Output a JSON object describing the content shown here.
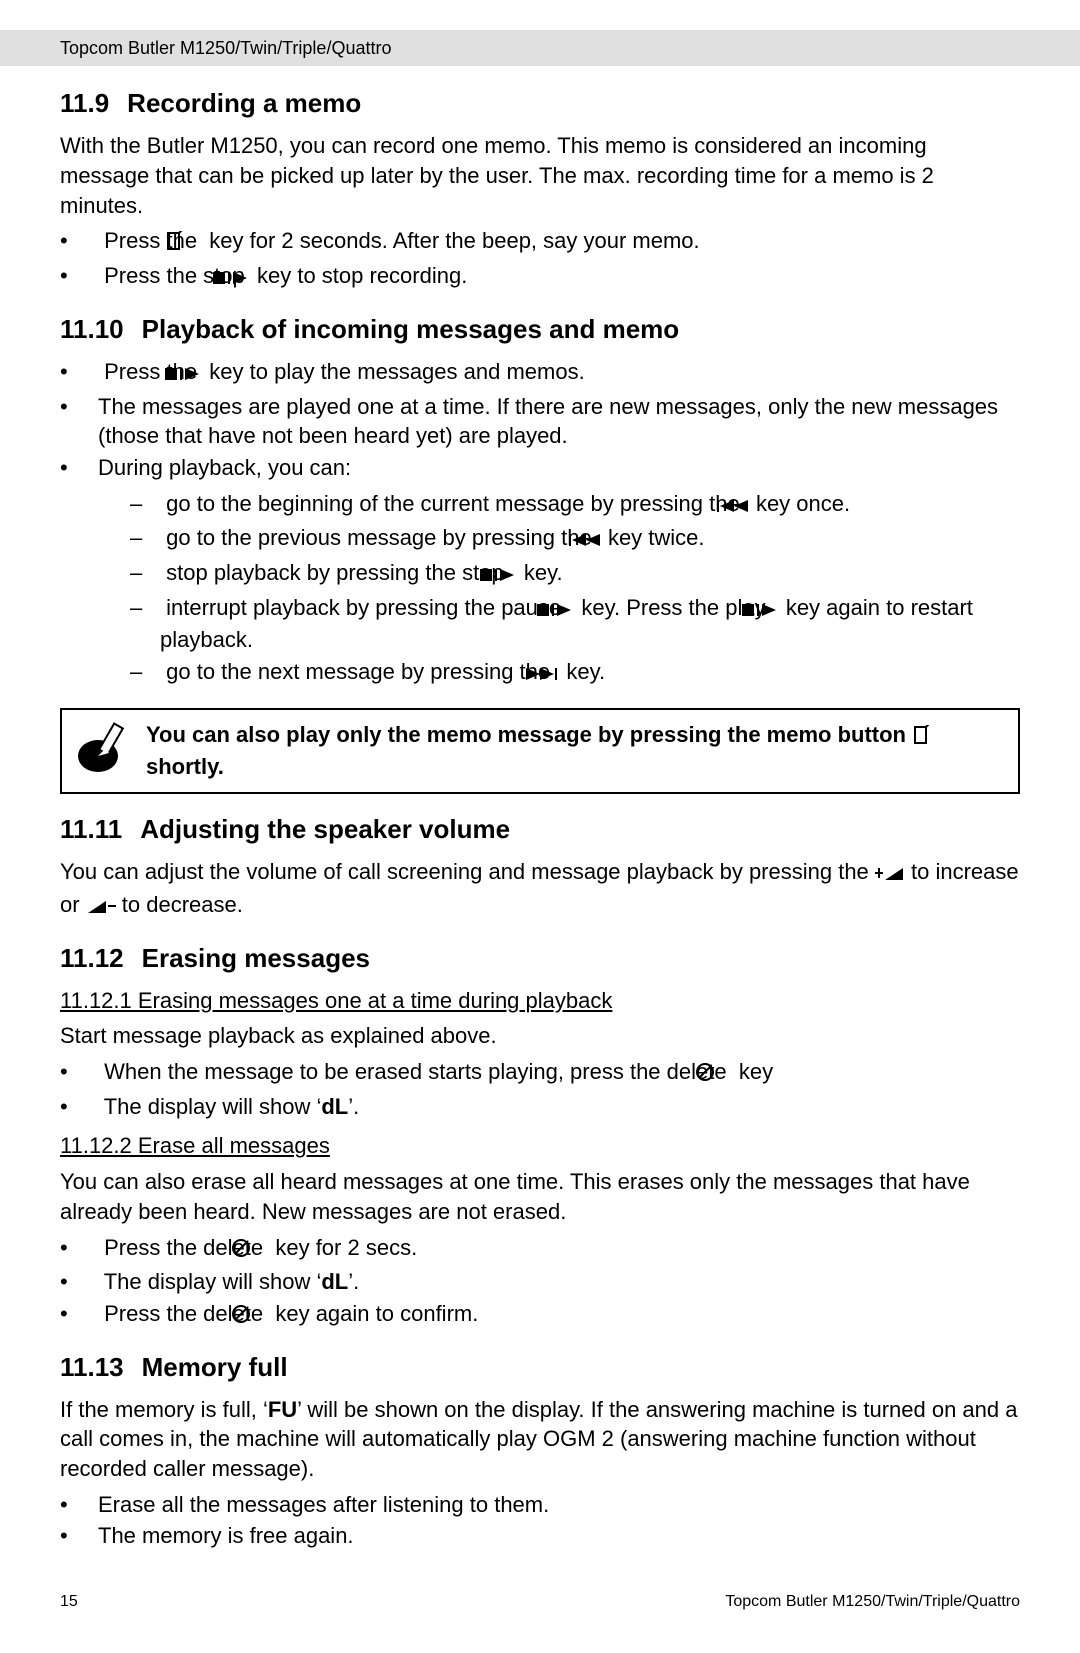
{
  "header": {
    "title": "Topcom Butler M1250/Twin/Triple/Quattro"
  },
  "s11_9": {
    "num": "11.9",
    "title": "Recording a memo",
    "intro": "With the Butler M1250, you can record one memo. This memo is considered an incoming message that can be picked up later by the user. The max. recording time for a memo is 2 minutes.",
    "b1a": "Press the ",
    "b1b": " key for 2 seconds. After the beep, say your memo.",
    "b2a": "Press the stop ",
    "b2b": " key to stop recording."
  },
  "s11_10": {
    "num": "11.10",
    "title": "Playback of incoming messages and memo",
    "b1a": "Press the ",
    "b1b": " key to play the messages and memos.",
    "b2": "The messages are played one at a time. If there are new messages, only the new messages (those that have not been heard yet) are played.",
    "b3": "During playback, you can:",
    "d1a": "go to the beginning of the current message by pressing the ",
    "d1b": " key once.",
    "d2a": "go to the previous message by pressing the ",
    "d2b": " key twice.",
    "d3a": "stop playback by pressing the stop ",
    "d3b": " key.",
    "d4a": "interrupt playback by pressing the pause ",
    "d4b": " key. Press the play ",
    "d4c": " key again to restart playback.",
    "d5a": "go to the next message by pressing the ",
    "d5b": " key."
  },
  "note": {
    "text_a": "You can also play only the memo message by pressing the memo button ",
    "text_b": " shortly."
  },
  "s11_11": {
    "num": "11.11",
    "title": "Adjusting the speaker volume",
    "text_a": "You can adjust the volume of call screening and message playback by pressing  the ",
    "text_b": " to increase or ",
    "text_c": " to decrease."
  },
  "s11_12": {
    "num": "11.12",
    "title": "Erasing messages",
    "sub1_title": "11.12.1 Erasing messages one at a time during playback",
    "sub1_intro": "Start message playback as explained above.",
    "sub1_b1a": "When the message to be erased starts playing, press the delete ",
    "sub1_b1b": " key",
    "sub1_b2a": "The display will show ‘",
    "sub1_b2b": "dL",
    "sub1_b2c": "’.",
    "sub2_title": "11.12.2 Erase all messages",
    "sub2_intro": "You can also erase all heard messages at one time. This erases only the messages that have already been heard. New messages are not erased.",
    "sub2_b1a": "Press the delete ",
    "sub2_b1b": " key for 2 secs.",
    "sub2_b2a": "The display will show ‘",
    "sub2_b2b": "dL",
    "sub2_b2c": "’.",
    "sub2_b3a": "Press the delete ",
    "sub2_b3b": " key again to confirm."
  },
  "s11_13": {
    "num": "11.13",
    "title": "Memory full",
    "intro_a": "If the memory is full, ‘",
    "intro_b": "FU",
    "intro_c": "’ will be shown on the display. If the answering machine is turned on and a call comes in, the machine will automatically play OGM 2 (answering machine function without recorded caller message).",
    "b1": "Erase all the messages after listening to them.",
    "b2": "The memory is free again."
  },
  "footer": {
    "page": "15",
    "right": "Topcom Butler M1250/Twin/Triple/Quattro"
  }
}
